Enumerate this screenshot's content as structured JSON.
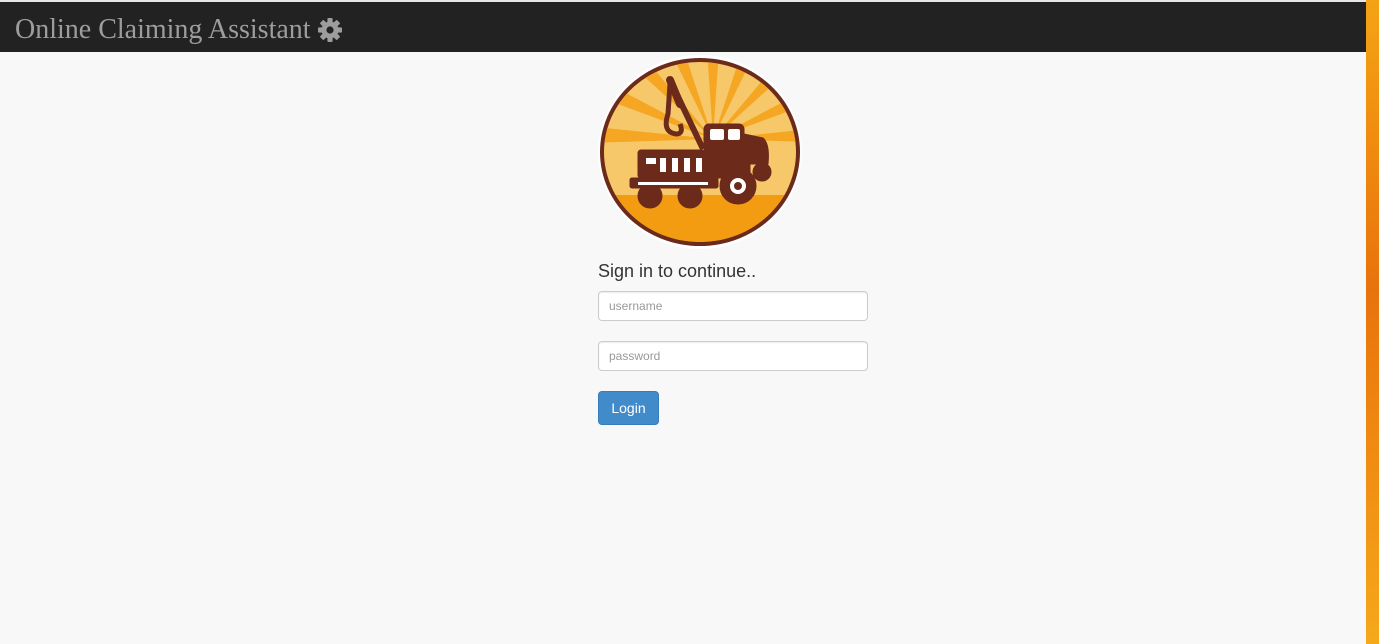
{
  "header": {
    "title": "Online Claiming Assistant",
    "icon": "gear-icon"
  },
  "logo": {
    "icon": "tow-truck-logo"
  },
  "form": {
    "heading": "Sign in to continue..",
    "username_placeholder": "username",
    "password_placeholder": "password",
    "login_label": "Login"
  },
  "colors": {
    "navbar": "#222222",
    "brand_text": "#9d9d9d",
    "primary_button": "#428bca",
    "background": "#f8f8f8",
    "logo_orange": "#f6a623",
    "logo_brown": "#6b2a1a"
  }
}
